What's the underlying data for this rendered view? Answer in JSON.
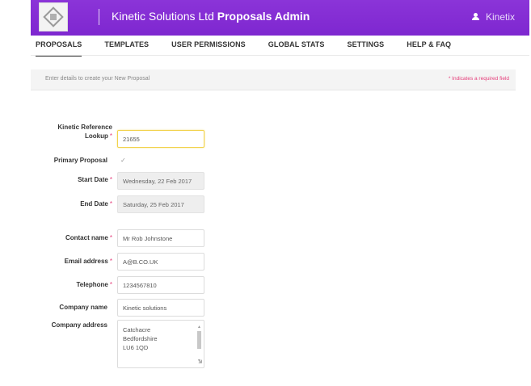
{
  "app": {
    "title_prefix": "Kinetic Solutions Ltd",
    "title_bold": "Proposals Admin",
    "user": "Kinetix"
  },
  "nav": {
    "items": [
      "PROPOSALS",
      "TEMPLATES",
      "USER PERMISSIONS",
      "GLOBAL STATS",
      "SETTINGS",
      "HELP & FAQ"
    ],
    "active": "PROPOSALS"
  },
  "info": {
    "instruction": "Enter details to create your New Proposal",
    "required_note": "* Indicates a required field"
  },
  "form": {
    "reference": {
      "label_line1": "Kinetic Reference",
      "label_line2": "Lookup",
      "value": "21655"
    },
    "primary": {
      "label": "Primary Proposal",
      "check": "✓"
    },
    "start_date": {
      "label": "Start Date",
      "value": "Wednesday, 22 Feb 2017"
    },
    "end_date": {
      "label": "End Date",
      "value": "Saturday, 25 Feb 2017"
    },
    "contact": {
      "label": "Contact name",
      "value": "Mr Rob Johnstone"
    },
    "email": {
      "label": "Email address",
      "value": "A@B.CO.UK"
    },
    "telephone": {
      "label": "Telephone",
      "value": "1234567810"
    },
    "company": {
      "label": "Company name",
      "value": "Kinetic solutions"
    },
    "address": {
      "label": "Company address",
      "lines": [
        "Catchacre",
        "Bedfordshire",
        "LU6 1QD"
      ]
    },
    "required_marker": "*"
  },
  "colors": {
    "brand": "#7e27d0",
    "accent_required": "#e53d7a",
    "focus": "#f2d24b"
  }
}
